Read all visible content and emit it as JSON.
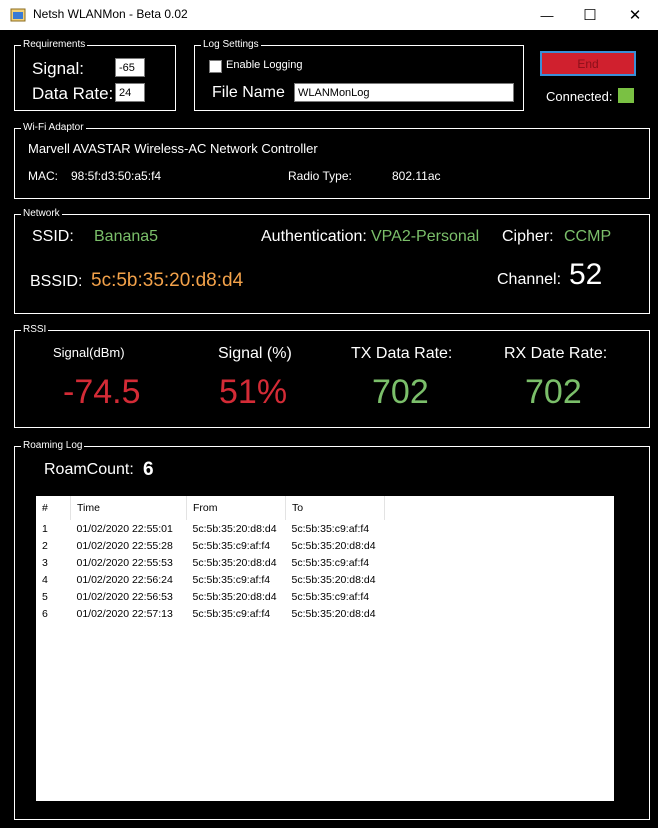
{
  "window": {
    "title": "Netsh WLANMon - Beta 0.02",
    "minimize": "—",
    "maximize": "☐",
    "close": "✕"
  },
  "requirements": {
    "legend": "Requirements",
    "signal_label": "Signal:",
    "signal_value": "-65",
    "data_rate_label": "Data Rate:",
    "data_rate_value": "24"
  },
  "log_settings": {
    "legend": "Log Settings",
    "enable_logging_label": "Enable Logging",
    "file_name_label": "File Name",
    "file_name_value": "WLANMonLog"
  },
  "end_button": "End",
  "connected_label": "Connected:",
  "colors": {
    "connected_indicator": "#7ac143",
    "end_button": "#d0202e",
    "value_green": "#7bbf6a",
    "value_red": "#d42b36",
    "bssid_orange": "#f3a24a"
  },
  "adaptor": {
    "legend": "Wi-Fi Adaptor",
    "name": "Marvell AVASTAR Wireless-AC Network Controller",
    "mac_label": "MAC:",
    "mac_value": "98:5f:d3:50:a5:f4",
    "radio_label": "Radio Type:",
    "radio_value": "802.11ac"
  },
  "network": {
    "legend": "Network",
    "ssid_label": "SSID:",
    "ssid_value": "Banana5",
    "auth_label": "Authentication:",
    "auth_value": "VPA2-Personal",
    "cipher_label": "Cipher:",
    "cipher_value": "CCMP",
    "bssid_label": "BSSID:",
    "bssid_value": "5c:5b:35:20:d8:d4",
    "channel_label": "Channel:",
    "channel_value": "52"
  },
  "rssi": {
    "legend": "RSSI",
    "signal_dbm_label": "Signal(dBm)",
    "signal_dbm_value": "-74.5",
    "signal_pct_label": "Signal (%)",
    "signal_pct_value": "51%",
    "tx_label": "TX Data Rate:",
    "tx_value": "702",
    "rx_label": "RX Date Rate:",
    "rx_value": "702"
  },
  "roaming": {
    "legend": "Roaming Log",
    "roam_count_label": "RoamCount:",
    "roam_count_value": "6",
    "columns": [
      "#",
      "Time",
      "From",
      "To"
    ],
    "rows": [
      [
        "1",
        "01/02/2020 22:55:01",
        "5c:5b:35:20:d8:d4",
        "5c:5b:35:c9:af:f4"
      ],
      [
        "2",
        "01/02/2020 22:55:28",
        "5c:5b:35:c9:af:f4",
        "5c:5b:35:20:d8:d4"
      ],
      [
        "3",
        "01/02/2020 22:55:53",
        "5c:5b:35:20:d8:d4",
        "5c:5b:35:c9:af:f4"
      ],
      [
        "4",
        "01/02/2020 22:56:24",
        "5c:5b:35:c9:af:f4",
        "5c:5b:35:20:d8:d4"
      ],
      [
        "5",
        "01/02/2020 22:56:53",
        "5c:5b:35:20:d8:d4",
        "5c:5b:35:c9:af:f4"
      ],
      [
        "6",
        "01/02/2020 22:57:13",
        "5c:5b:35:c9:af:f4",
        "5c:5b:35:20:d8:d4"
      ]
    ]
  }
}
